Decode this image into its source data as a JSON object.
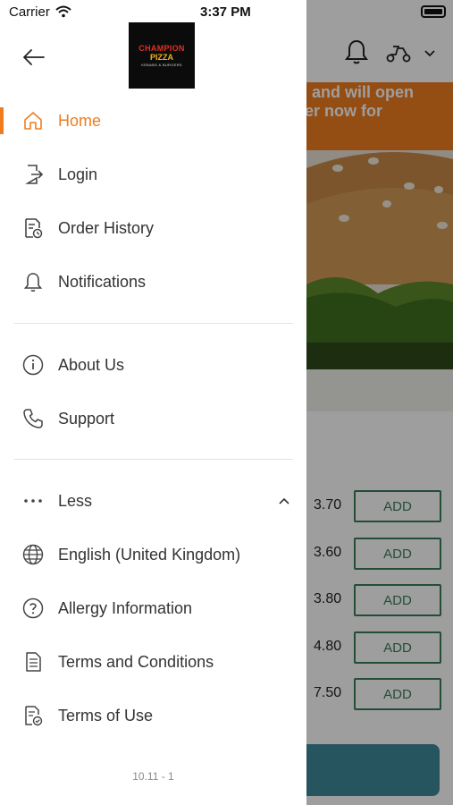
{
  "status_bar": {
    "carrier": "Carrier",
    "time": "3:37 PM"
  },
  "drawer": {
    "logo": {
      "line1": "CHAMPION",
      "line2": "PIZZA",
      "line3": "KEBABS & BURGERS"
    },
    "primary_items": [
      {
        "label": "Home",
        "icon": "home-icon",
        "active": true
      },
      {
        "label": "Login",
        "icon": "login-icon"
      },
      {
        "label": "Order History",
        "icon": "order-history-icon"
      },
      {
        "label": "Notifications",
        "icon": "bell-icon"
      }
    ],
    "secondary_items": [
      {
        "label": "About Us",
        "icon": "info-icon"
      },
      {
        "label": "Support",
        "icon": "phone-icon"
      }
    ],
    "more_items": [
      {
        "label": "Less",
        "icon": "more-dots-icon"
      },
      {
        "label": "English (United Kingdom)",
        "icon": "globe-icon"
      },
      {
        "label": "Allergy Information",
        "icon": "question-icon"
      },
      {
        "label": "Terms and Conditions",
        "icon": "document-icon"
      },
      {
        "label": "Terms of Use",
        "icon": "document-check-icon"
      }
    ],
    "version": "10.11 - 1"
  },
  "background": {
    "banner_line1": "d and will open",
    "banner_line2": "rder now for",
    "items": [
      {
        "price": "3.70",
        "add": "ADD"
      },
      {
        "price": "3.60",
        "add": "ADD"
      },
      {
        "price": "3.80",
        "add": "ADD"
      },
      {
        "price": "4.80",
        "add": "ADD"
      },
      {
        "price": "7.50",
        "add": "ADD"
      }
    ]
  },
  "colors": {
    "accent": "#ef7d20",
    "text": "#333333",
    "add_green": "#3a7d5a",
    "cta": "#3f8a9a"
  }
}
